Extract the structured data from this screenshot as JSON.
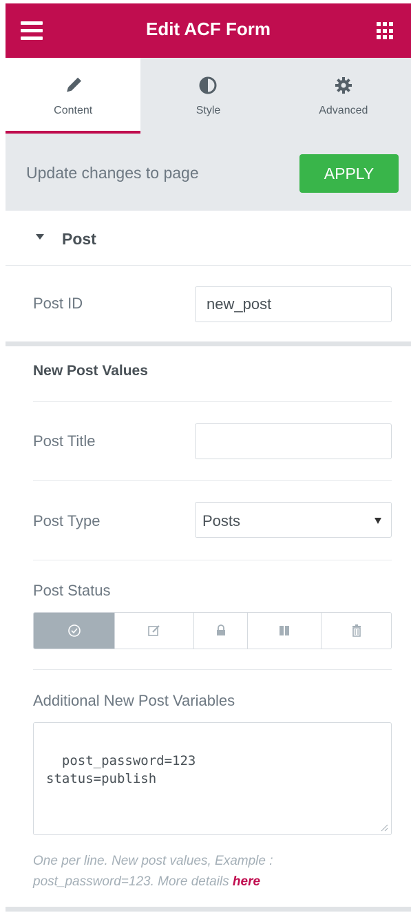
{
  "header": {
    "title": "Edit ACF Form"
  },
  "tabs": [
    {
      "label": "Content",
      "icon": "pencil-icon",
      "active": true
    },
    {
      "label": "Style",
      "icon": "half-circle-icon",
      "active": false
    },
    {
      "label": "Advanced",
      "icon": "gear-icon",
      "active": false
    }
  ],
  "apply": {
    "text": "Update changes to page",
    "button": "APPLY"
  },
  "section": {
    "title": "Post"
  },
  "post_id": {
    "label": "Post ID",
    "value": "new_post"
  },
  "new_post": {
    "heading": "New Post Values",
    "title_label": "Post Title",
    "title_value": "",
    "type_label": "Post Type",
    "type_value": "Posts",
    "status_label": "Post Status",
    "status_options": [
      "publish-icon",
      "draft-icon",
      "private-icon",
      "pending-icon",
      "trash-icon"
    ],
    "status_selected": "publish-icon"
  },
  "additional": {
    "label": "Additional New Post Variables",
    "value": "post_password=123\nstatus=publish",
    "description": "One per line. New post values, Example : post_password=123. More details ",
    "link": "here"
  },
  "colors": {
    "brand": "#c00d4f",
    "apply": "#39b54a",
    "active_choice": "#a4afb7"
  }
}
